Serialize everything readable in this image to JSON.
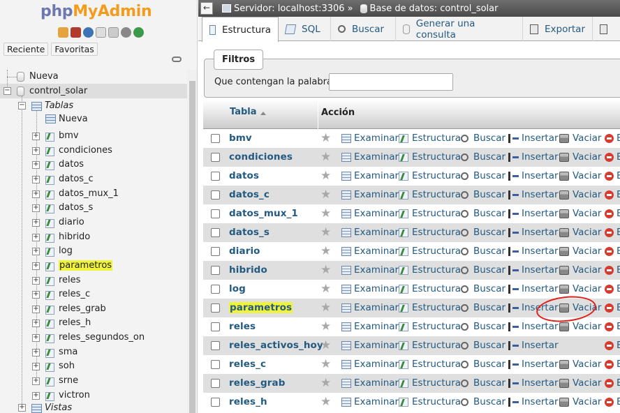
{
  "logo": {
    "part1": "php",
    "part2": "MyAdmin"
  },
  "nav": {
    "recent_label": "Reciente",
    "favorites_label": "Favoritas",
    "tree": {
      "new_label": "Nueva",
      "database": "control_solar",
      "tables_group": "Tablas",
      "tables_new": "Nueva",
      "tables": [
        "bmv",
        "condiciones",
        "datos",
        "datos_c",
        "datos_mux_1",
        "datos_s",
        "diario",
        "hibrido",
        "log",
        "parametros",
        "reles",
        "reles_c",
        "reles_grab",
        "reles_h",
        "reles_segundos_on",
        "sma",
        "soh",
        "srne",
        "victron"
      ],
      "highlighted_table": "parametros",
      "views_group": "Vistas"
    }
  },
  "breadcrumb": {
    "server": "Servidor: localhost:3306",
    "separator": "»",
    "database": "Base de datos: control_solar"
  },
  "menu": {
    "tabs": [
      "Estructura",
      "SQL",
      "Buscar",
      "Generar una consulta",
      "Exportar"
    ],
    "active": "Estructura"
  },
  "filters": {
    "legend": "Filtros",
    "label": "Que contengan la palabra:",
    "value": ""
  },
  "table": {
    "col_table": "Tabla",
    "col_action": "Acción",
    "actions": [
      "Examinar",
      "Estructura",
      "Buscar",
      "Insertar",
      "Vaciar"
    ],
    "rows": [
      {
        "name": "bmv",
        "vaciar": true
      },
      {
        "name": "condiciones",
        "vaciar": true
      },
      {
        "name": "datos",
        "vaciar": true
      },
      {
        "name": "datos_c",
        "vaciar": true
      },
      {
        "name": "datos_mux_1",
        "vaciar": true
      },
      {
        "name": "datos_s",
        "vaciar": true
      },
      {
        "name": "diario",
        "vaciar": true
      },
      {
        "name": "hibrido",
        "vaciar": true
      },
      {
        "name": "log",
        "vaciar": true
      },
      {
        "name": "parametros",
        "vaciar": true,
        "highlight": true
      },
      {
        "name": "reles",
        "vaciar": true
      },
      {
        "name": "reles_activos_hoy",
        "vaciar": false
      },
      {
        "name": "reles_c",
        "vaciar": true
      },
      {
        "name": "reles_grab",
        "vaciar": true
      },
      {
        "name": "reles_h",
        "vaciar": true
      }
    ],
    "truncated_letter": "E"
  },
  "colors": {
    "link": "#235a81",
    "highlight": "#f0f33b",
    "annotation": "#e0201a",
    "logo_php": "#6c78af",
    "logo_myadmin": "#f29b1d"
  }
}
